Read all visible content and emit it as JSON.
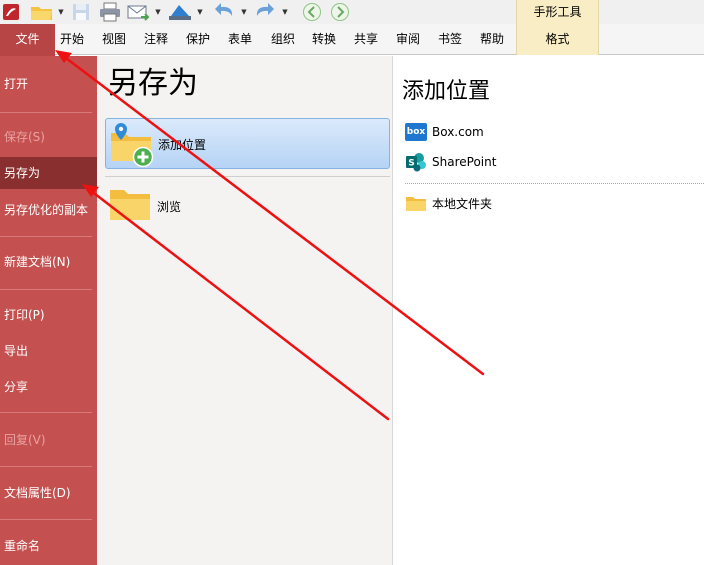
{
  "quick_access": {
    "icons": [
      "app-logo-icon",
      "open-folder-icon",
      "save-icon",
      "print-icon",
      "email-icon",
      "scan-icon",
      "undo-icon",
      "redo-icon",
      "back-icon",
      "forward-icon"
    ],
    "context_group": "手形工具"
  },
  "menu": {
    "file": "文件",
    "tabs": [
      "开始",
      "视图",
      "注释",
      "保护",
      "表单",
      "组织",
      "转换",
      "共享",
      "审阅",
      "书签",
      "帮助"
    ],
    "context_tab": "格式"
  },
  "nav": {
    "open": "打开",
    "save": "保存(S)",
    "save_as": "另存为",
    "save_optimized": "另存优化的副本",
    "new_document": "新建文档(N)",
    "print": "打印(P)",
    "export": "导出",
    "share": "分享",
    "revert": "回复(V)",
    "properties": "文档属性(D)",
    "rename": "重命名"
  },
  "middle": {
    "title": "另存为",
    "add_location": "添加位置",
    "browse": "浏览"
  },
  "right": {
    "title": "添加位置",
    "box": "Box.com",
    "box_logo": "box",
    "sharepoint": "SharePoint",
    "local_folder": "本地文件夹"
  },
  "colors": {
    "accent": "#c55050",
    "nav_selected": "#8a2f2f",
    "annotation_arrow": "#ee1111"
  }
}
